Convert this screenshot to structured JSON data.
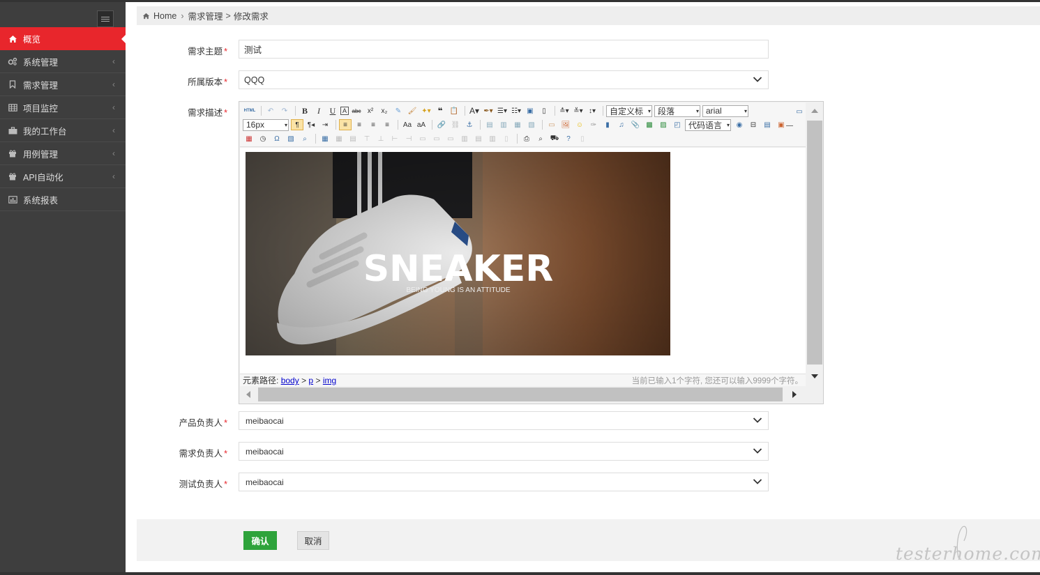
{
  "sidebar": {
    "items": [
      {
        "label": "概览",
        "icon": "home-icon",
        "active": true
      },
      {
        "label": "系统管理",
        "icon": "gears-icon"
      },
      {
        "label": "需求管理",
        "icon": "bookmark-icon"
      },
      {
        "label": "项目监控",
        "icon": "table-icon"
      },
      {
        "label": "我的工作台",
        "icon": "briefcase-icon"
      },
      {
        "label": "用例管理",
        "icon": "gift-icon"
      },
      {
        "label": "API自动化",
        "icon": "gift-icon"
      },
      {
        "label": "系统报表",
        "icon": "bar-chart-icon"
      }
    ],
    "chevron": "‹"
  },
  "breadcrumb": {
    "home": "Home",
    "sep1": "›",
    "level1": "需求管理",
    "sep2": ">",
    "level2": "修改需求"
  },
  "form": {
    "title_label": "需求主题",
    "title_value": "测试",
    "version_label": "所属版本",
    "version_value": "QQQ",
    "desc_label": "需求描述",
    "product_owner_label": "产品负责人",
    "product_owner_value": "meibaocai",
    "req_owner_label": "需求负责人",
    "req_owner_value": "meibaocai",
    "test_owner_label": "测试负责人",
    "test_owner_value": "meibaocai",
    "required_mark": "*"
  },
  "editor": {
    "toolbar": {
      "html_btn": "HTML",
      "bold": "B",
      "italic": "I",
      "underline": "U",
      "custom_heading": "自定义标",
      "paragraph": "段落",
      "font_family": "arial",
      "font_size": "16px",
      "code_lang": "代码语言"
    },
    "image": {
      "headline": "SNEAKER",
      "tagline": "BEING YOUNG IS AN ATTITUDE"
    },
    "status": {
      "path_label": "元素路径:",
      "path_body": "body",
      "path_sep": ">",
      "path_p": "p",
      "path_img": "img",
      "count": "当前已输入1个字符, 您还可以输入9999个字符。"
    }
  },
  "actions": {
    "confirm": "确认",
    "cancel": "取消"
  },
  "watermark": "testerhome.com",
  "colors": {
    "sidebar_bg": "#3e3e3e",
    "active_item": "#e8262c",
    "confirm_btn": "#2ea33b",
    "required": "#e8262c"
  }
}
